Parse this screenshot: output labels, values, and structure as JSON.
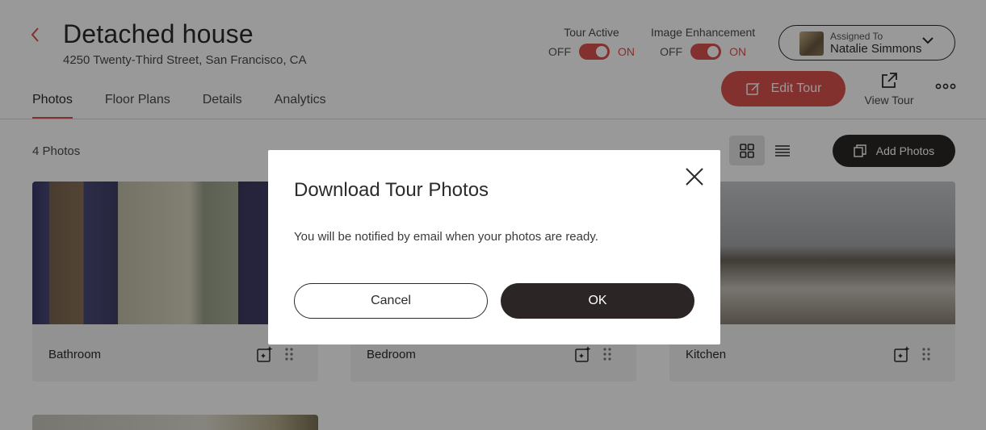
{
  "header": {
    "title": "Detached house",
    "address": "4250 Twenty-Third Street, San Francisco, CA"
  },
  "toggles": [
    {
      "label": "Tour Active",
      "off": "OFF",
      "on": "ON",
      "state": "on"
    },
    {
      "label": "Image Enhancement",
      "off": "OFF",
      "on": "ON",
      "state": "on"
    }
  ],
  "assigned": {
    "label": "Assigned To",
    "name": "Natalie Simmons"
  },
  "actions": {
    "edit_tour": "Edit Tour",
    "view_tour": "View Tour"
  },
  "tabs": [
    {
      "label": "Photos",
      "active": true
    },
    {
      "label": "Floor Plans",
      "active": false
    },
    {
      "label": "Details",
      "active": false
    },
    {
      "label": "Analytics",
      "active": false
    }
  ],
  "toolbar": {
    "photo_count": "4 Photos",
    "add_photos": "Add Photos"
  },
  "photos": [
    {
      "name": "Bathroom"
    },
    {
      "name": "Bedroom"
    },
    {
      "name": "Kitchen"
    }
  ],
  "modal": {
    "title": "Download Tour Photos",
    "body": "You will be notified by email when your photos are ready.",
    "cancel": "Cancel",
    "ok": "OK"
  },
  "colors": {
    "accent": "#d9534f",
    "dark": "#2b2525",
    "overlay": "rgba(0,0,0,0.4)"
  }
}
